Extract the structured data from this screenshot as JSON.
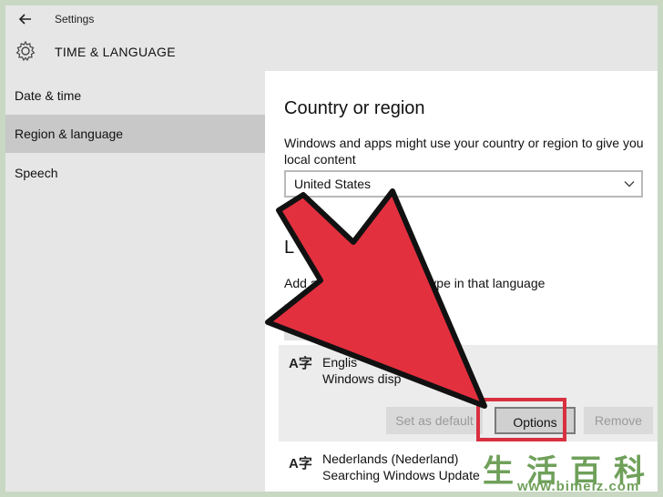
{
  "window": {
    "title": "Settings"
  },
  "header": {
    "section_title": "TIME & LANGUAGE"
  },
  "sidebar": {
    "items": [
      {
        "label": "Date & time",
        "active": false
      },
      {
        "label": "Region & language",
        "active": true
      },
      {
        "label": "Speech",
        "active": false
      }
    ]
  },
  "main": {
    "country_heading": "Country or region",
    "country_desc": "Windows and apps might use your country or region to give you local content",
    "country_value": "United States",
    "languages_heading": "L            es",
    "add_text": "Add a la                            ype in that language",
    "languages": [
      {
        "name": "Englis",
        "subtitle": "Windows disp",
        "icon": "language-icon"
      },
      {
        "name": "Nederlands (Nederland)",
        "subtitle": "Searching Windows Update",
        "icon": "language-icon"
      }
    ],
    "buttons": {
      "set_default": "Set as default",
      "options": "Options",
      "remove": "Remove"
    }
  },
  "watermark": {
    "chars": [
      "生",
      "活",
      "百",
      "科"
    ],
    "url": "www.bimeiz.com"
  },
  "colors": {
    "accent_red": "#d9303f",
    "arrow_red": "#e3303f",
    "watermark_green": "#6fa05a"
  }
}
